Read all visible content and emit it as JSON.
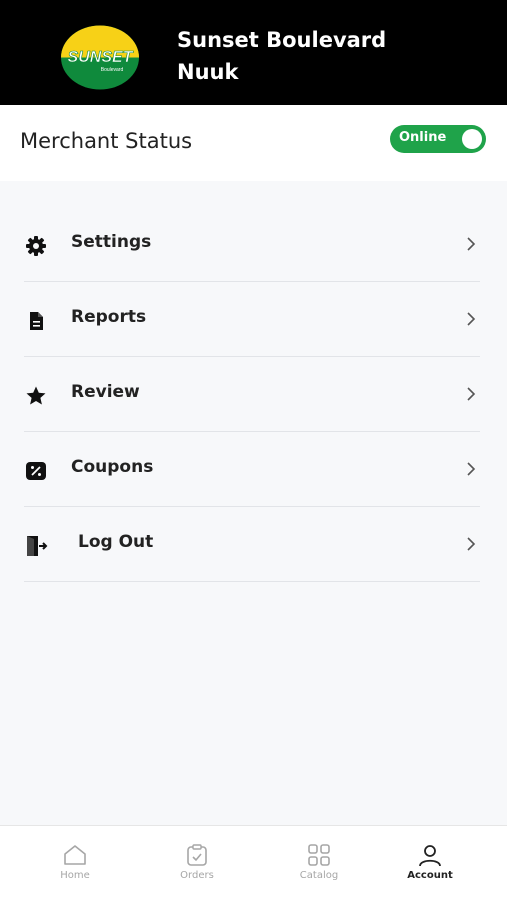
{
  "header": {
    "logo_text": "SUNSET",
    "logo_subtext": "Boulevard",
    "store_name_line1": "Sunset Boulevard",
    "store_name_line2": "Nuuk"
  },
  "status": {
    "label": "Merchant Status",
    "toggle_label": "Online",
    "toggle_on": true,
    "toggle_color": "#1fa34a"
  },
  "menu": {
    "items": [
      {
        "label": "Settings",
        "icon": "gear-icon"
      },
      {
        "label": "Reports",
        "icon": "document-icon"
      },
      {
        "label": "Review",
        "icon": "star-icon"
      },
      {
        "label": "Coupons",
        "icon": "coupon-icon"
      },
      {
        "label": "Log Out",
        "icon": "logout-icon"
      }
    ]
  },
  "tabbar": {
    "tabs": [
      {
        "label": "Home",
        "icon": "home-icon",
        "active": false
      },
      {
        "label": "Orders",
        "icon": "orders-icon",
        "active": false
      },
      {
        "label": "Catalog",
        "icon": "catalog-icon",
        "active": false
      },
      {
        "label": "Account",
        "icon": "account-icon",
        "active": true
      }
    ]
  },
  "colors": {
    "header_bg": "#000000",
    "logo_yellow": "#f7d117",
    "logo_green": "#0f8a3c",
    "accent_green": "#1fa34a"
  }
}
